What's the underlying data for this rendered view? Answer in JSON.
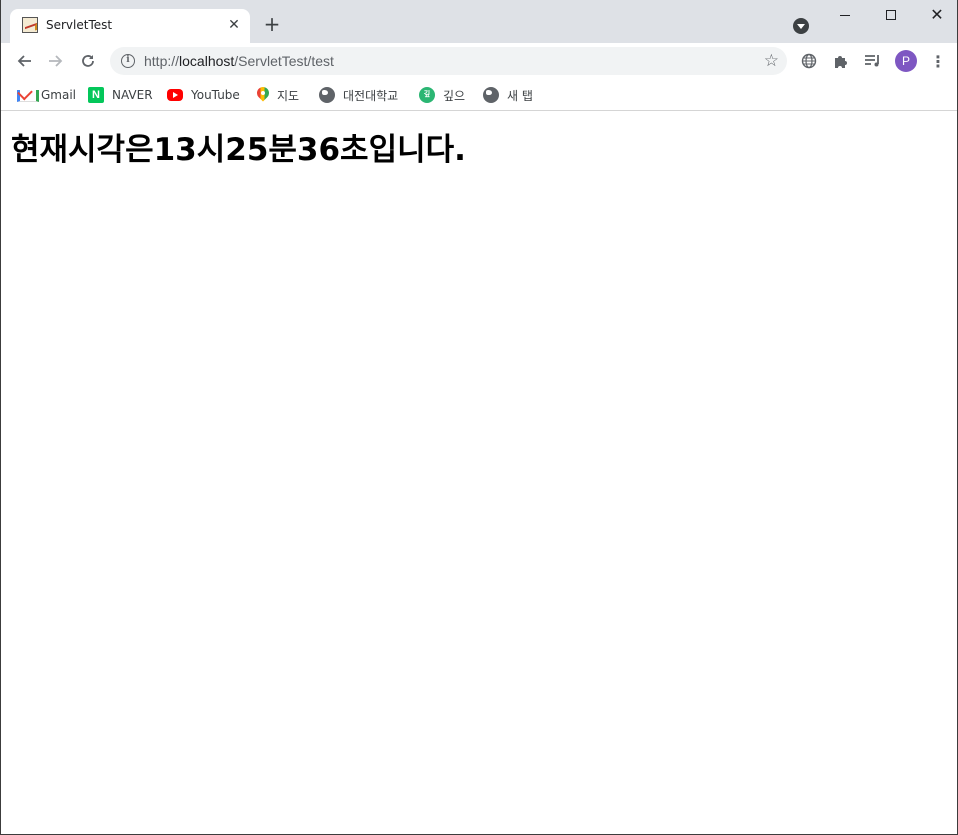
{
  "window": {
    "tab": {
      "title": "ServletTest",
      "close_glyph": "✕"
    },
    "new_tab_glyph": "+",
    "controls": {
      "minimize": "minimize-icon",
      "maximize": "maximize-icon",
      "close_glyph": "✕"
    }
  },
  "toolbar": {
    "back_glyph": "←",
    "forward_glyph": "→",
    "reload_glyph": "↻",
    "url": {
      "scheme": "http://",
      "host": "localhost",
      "path": "/ServletTest/test"
    },
    "bookmark_star_glyph": "☆",
    "profile_initial": "P",
    "menu_glyph": "⋮"
  },
  "bookmarks": [
    {
      "label": "Gmail",
      "icon": "gmail-icon"
    },
    {
      "label": "NAVER",
      "icon": "naver-icon",
      "icon_text": "N"
    },
    {
      "label": "YouTube",
      "icon": "youtube-icon"
    },
    {
      "label": "지도",
      "icon": "maps-icon"
    },
    {
      "label": "대전대학교",
      "icon": "globe-icon"
    },
    {
      "label": "깊으",
      "icon": "gipeun-icon",
      "icon_text": "깊"
    },
    {
      "label": "새 탭",
      "icon": "globe-icon"
    }
  ],
  "page": {
    "heading": "현재시각은13시25분36초입니다."
  },
  "colors": {
    "tabstrip": "#dee1e6",
    "omnibox": "#f1f3f4",
    "avatar": "#7e57c2",
    "naver": "#03c75a",
    "youtube": "#ff0000"
  }
}
